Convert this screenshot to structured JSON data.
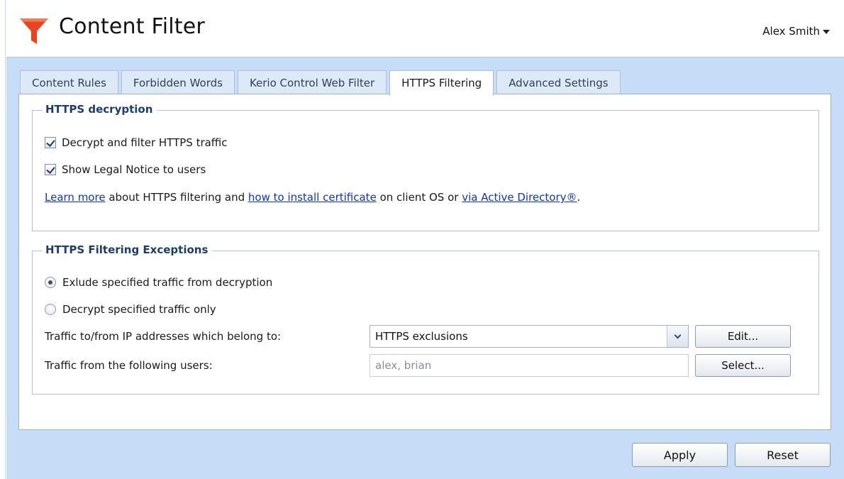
{
  "app": {
    "title": "Content Filter",
    "user": "Alex Smith"
  },
  "tabs": [
    {
      "label": "Content Rules"
    },
    {
      "label": "Forbidden Words"
    },
    {
      "label": "Kerio Control Web Filter"
    },
    {
      "label": "HTTPS Filtering",
      "active": true
    },
    {
      "label": "Advanced Settings"
    }
  ],
  "decryption": {
    "legend": "HTTPS decryption",
    "decrypt_label": "Decrypt and filter HTTPS traffic",
    "decrypt_checked": true,
    "legal_label": "Show Legal Notice to users",
    "legal_checked": true,
    "info": {
      "link1": "Learn more",
      "text1": " about HTTPS filtering and ",
      "link2": "how to install certificate",
      "text2": " on client OS or ",
      "link3": "via Active Directory®",
      "text3": "."
    }
  },
  "exceptions": {
    "legend": "HTTPS Filtering Exceptions",
    "option_exclude": "Exlude specified traffic from decryption",
    "option_decrypt_only": "Decrypt specified traffic only",
    "selected_option": "exclude",
    "ip_label": "Traffic to/from IP addresses which belong to:",
    "ip_value": "HTTPS exclusions",
    "edit_label": "Edit...",
    "users_label": "Traffic from the following users:",
    "users_value": "alex, brian",
    "select_label": "Select..."
  },
  "footer": {
    "apply_label": "Apply",
    "reset_label": "Reset"
  },
  "colors": {
    "accent_logo": "#e8441f",
    "workspace_bg": "#c7dcf7",
    "legend_text": "#1c3d6e",
    "link": "#0b36c9"
  },
  "icons": {
    "logo": "funnel-icon",
    "user_menu": "caret-down-icon",
    "combo": "chevron-down-icon"
  }
}
